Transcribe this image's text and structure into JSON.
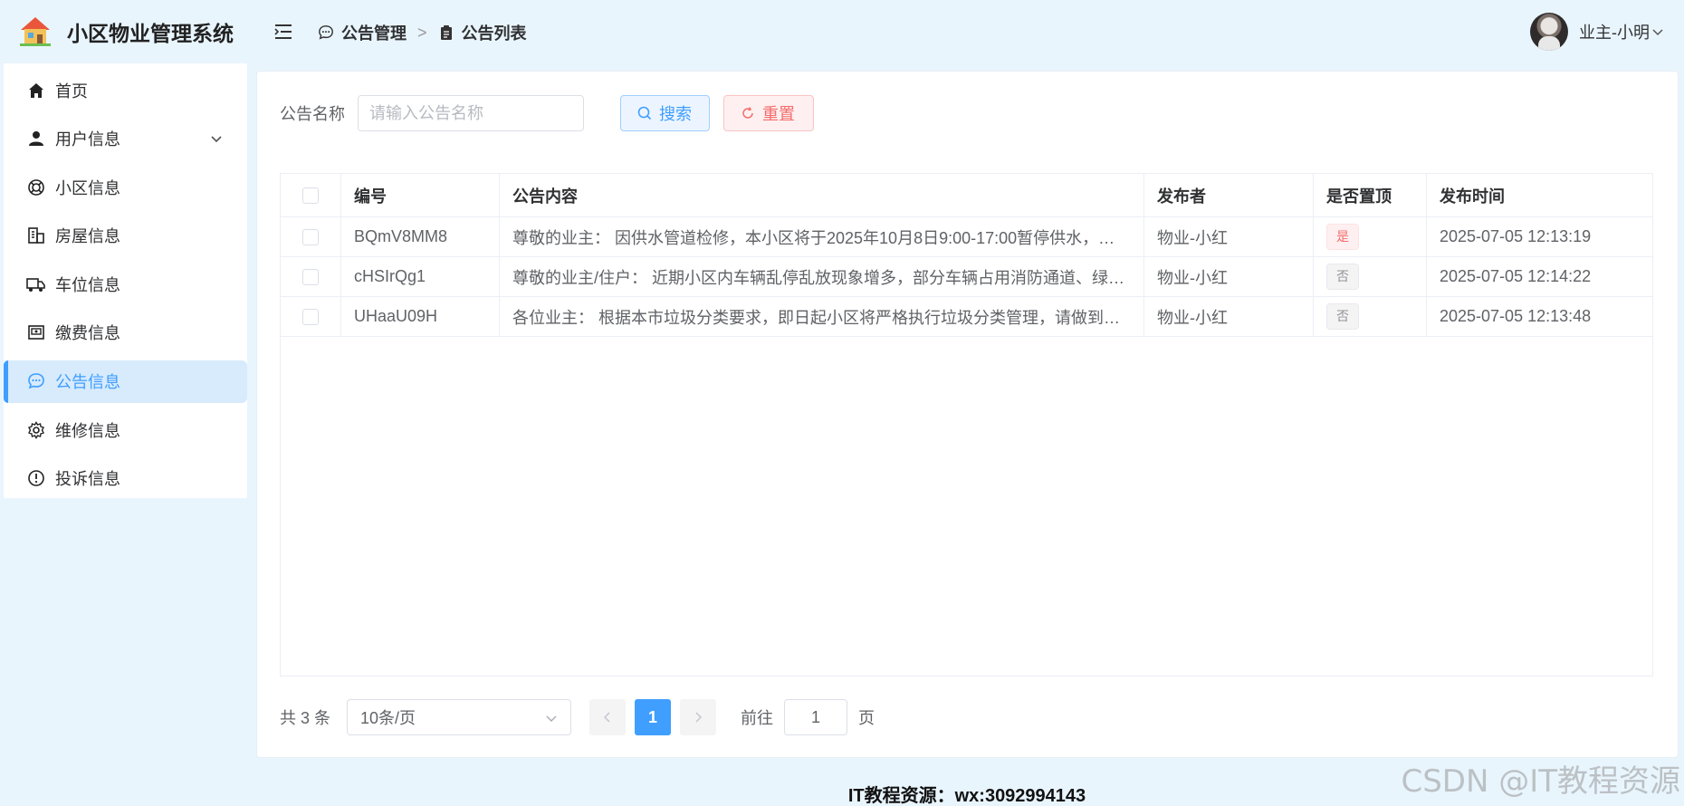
{
  "app": {
    "title": "小区物业管理系统"
  },
  "sidebar": {
    "items": [
      {
        "label": "首页",
        "icon": "home-icon"
      },
      {
        "label": "用户信息",
        "icon": "user-icon"
      },
      {
        "label": "小区信息",
        "icon": "lifebuoy-icon"
      },
      {
        "label": "房屋信息",
        "icon": "building-icon"
      },
      {
        "label": "车位信息",
        "icon": "truck-icon"
      },
      {
        "label": "缴费信息",
        "icon": "wallet-icon"
      },
      {
        "label": "公告信息",
        "icon": "chat-icon"
      },
      {
        "label": "维修信息",
        "icon": "gear-icon"
      },
      {
        "label": "投诉信息",
        "icon": "warning-icon"
      }
    ],
    "active": "公告信息"
  },
  "header": {
    "breadcrumb": [
      "公告管理",
      "公告列表"
    ],
    "user": "业主-小明"
  },
  "search": {
    "label": "公告名称",
    "placeholder": "请输入公告名称",
    "search_label": "搜索",
    "reset_label": "重置"
  },
  "table": {
    "columns": [
      "编号",
      "公告内容",
      "发布者",
      "是否置顶",
      "发布时间"
    ],
    "rows": [
      {
        "code": "BQmV8MM8",
        "content": "尊敬的业主： 因供水管道检修，本小区将于2025年10月8日9:00-17:00暂停供水，请...",
        "publisher": "物业-小红",
        "top": "是",
        "time": "2025-07-05 12:13:19"
      },
      {
        "code": "cHSIrQg1",
        "content": "尊敬的业主/住户： 近期小区内车辆乱停乱放现象增多，部分车辆占用消防通道、绿化...",
        "publisher": "物业-小红",
        "top": "否",
        "time": "2025-07-05 12:14:22"
      },
      {
        "code": "UHaaU09H",
        "content": "各位业主： 根据本市垃圾分类要求，即日起小区将严格执行垃圾分类管理，请做到： ...",
        "publisher": "物业-小红",
        "top": "否",
        "time": "2025-07-05 12:13:48"
      }
    ]
  },
  "pagination": {
    "total": "共 3 条",
    "page_size": "10条/页",
    "current": "1",
    "goto_label": "前往",
    "goto_value": "1",
    "page_suffix": "页"
  },
  "footer": {
    "text": "IT教程资源：wx:3092994143"
  },
  "watermark": "CSDN @IT教程资源",
  "colors": {
    "accent": "#409eff",
    "danger": "#f56c6c",
    "background": "#e9f5fd"
  }
}
